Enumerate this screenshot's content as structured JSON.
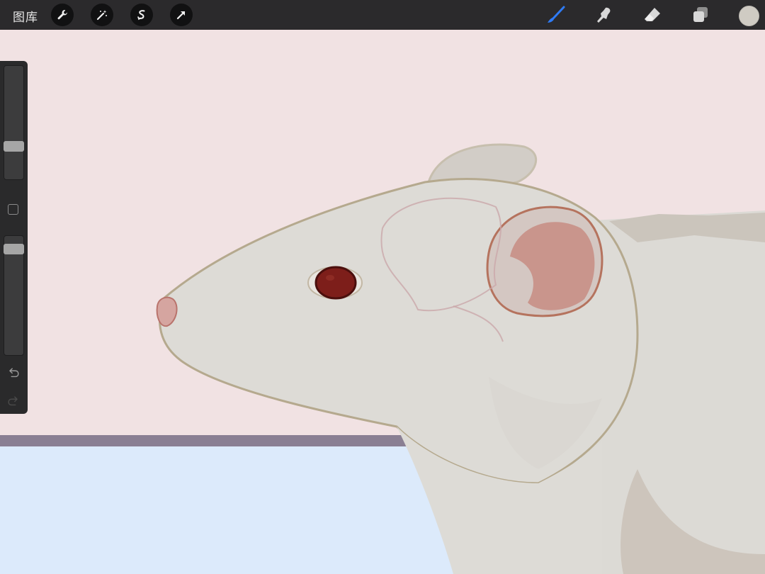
{
  "topbar": {
    "gallery_label": "图库",
    "left_tools": [
      "wrench-icon",
      "magic-wand-icon",
      "selection-icon",
      "transform-arrow-icon"
    ],
    "right_tools": [
      "brush-icon",
      "smudge-icon",
      "eraser-icon",
      "layers-icon"
    ],
    "active_tool": "brush-icon",
    "active_tool_color": "#2f7bf5",
    "current_color": "#cfcbc3"
  },
  "sidebar": {
    "brush_size_level": 0.27,
    "opacity_level": 0.07,
    "undo_icon": "undo-icon",
    "redo_icon": "redo-icon"
  },
  "canvas": {
    "background_color": "#f1e2e3",
    "floor_color": "#dceafb",
    "subject": "rat-illustration"
  }
}
